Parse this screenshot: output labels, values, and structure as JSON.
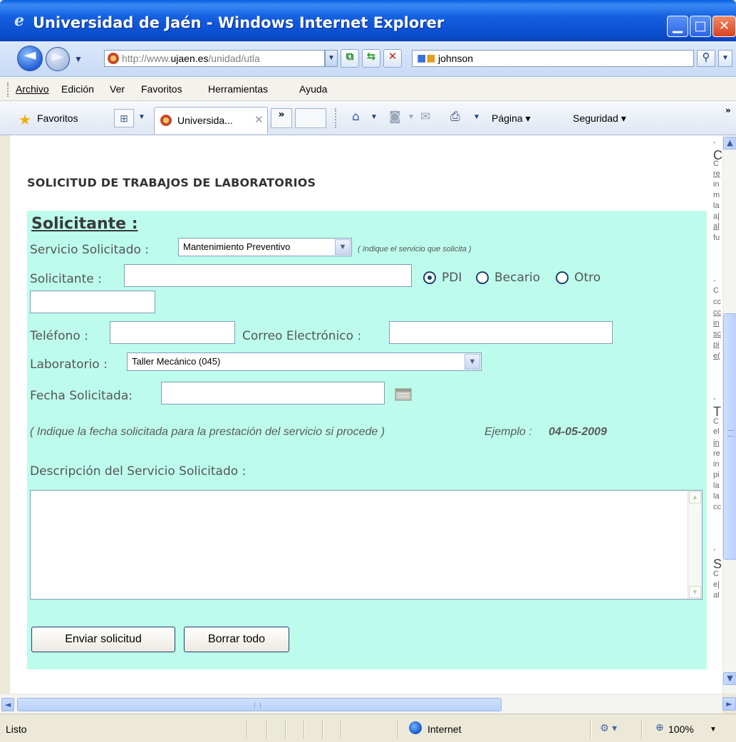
{
  "window": {
    "title": "Universidad de Jaén - Windows Internet Explorer"
  },
  "address": {
    "url_prefix": "http://www.",
    "url_domain": "ujaen.es",
    "url_path": "/unidad/utla"
  },
  "search": {
    "value": "johnson"
  },
  "menu": {
    "items": [
      "Archivo",
      "Edición",
      "Ver",
      "Favoritos",
      "Herramientas",
      "Ayuda"
    ]
  },
  "favorites_bar": {
    "favorites_label": "Favoritos",
    "active_tab": "Universida...",
    "more_tabs": "»",
    "page_menu": "Página",
    "security_menu": "Seguridad",
    "overflow": "»"
  },
  "page": {
    "heading": "SOLICITUD DE TRABAJOS DE LABORATORIOS",
    "form": {
      "title": "Solicitante :",
      "servicio_label": "Servicio Solicitado :",
      "servicio_value": "Mantenimiento Preventivo",
      "servicio_hint": "( Indique el servicio que solicita )",
      "solicitante_label": "Solicitante :",
      "solicitante_value": "",
      "radio_options": [
        "PDI",
        "Becario",
        "Otro"
      ],
      "radio_selected": "PDI",
      "otro_value": "",
      "telefono_label": "Teléfono :",
      "telefono_value": "",
      "correo_label": "Correo Electrónico :",
      "correo_value": "",
      "laboratorio_label": "Laboratorio :",
      "laboratorio_value": "Taller Mecánico (045)",
      "fecha_label": "Fecha Solicitada:",
      "fecha_value": "",
      "fecha_hint": "( Indique la fecha solicitada para la prestación del servicio si procede )",
      "fecha_example_label": "Ejemplo :",
      "fecha_example_value": "04-05-2009",
      "descripcion_label": "Descripción del Servicio Solicitado :",
      "descripcion_value": "",
      "submit_label": "Enviar solicitud",
      "reset_label": "Borrar todo"
    },
    "side_column": [
      "-",
      "C",
      "C",
      "re",
      "in",
      "m",
      "la",
      "a|",
      "a|",
      "fu",
      "-",
      "C",
      "cc",
      "cc",
      "in",
      "sc",
      "pi",
      "e(",
      "-",
      "T",
      "C",
      "el",
      "in",
      "re",
      "in",
      "pi",
      "la",
      "la",
      "cc",
      "-",
      "S",
      "C",
      "e|",
      "al"
    ]
  },
  "status": {
    "text": "Listo",
    "zone": "Internet",
    "zoom": "100%"
  },
  "colors": {
    "form_background": "#bdfcec",
    "title_bar": "#0b4fcf"
  },
  "icons": {
    "back": "back-arrow-icon",
    "forward": "forward-arrow-icon",
    "calendar": "calendar-icon",
    "home": "home-icon",
    "feeds": "rss-icon",
    "mail": "mail-icon",
    "print": "printer-icon"
  }
}
